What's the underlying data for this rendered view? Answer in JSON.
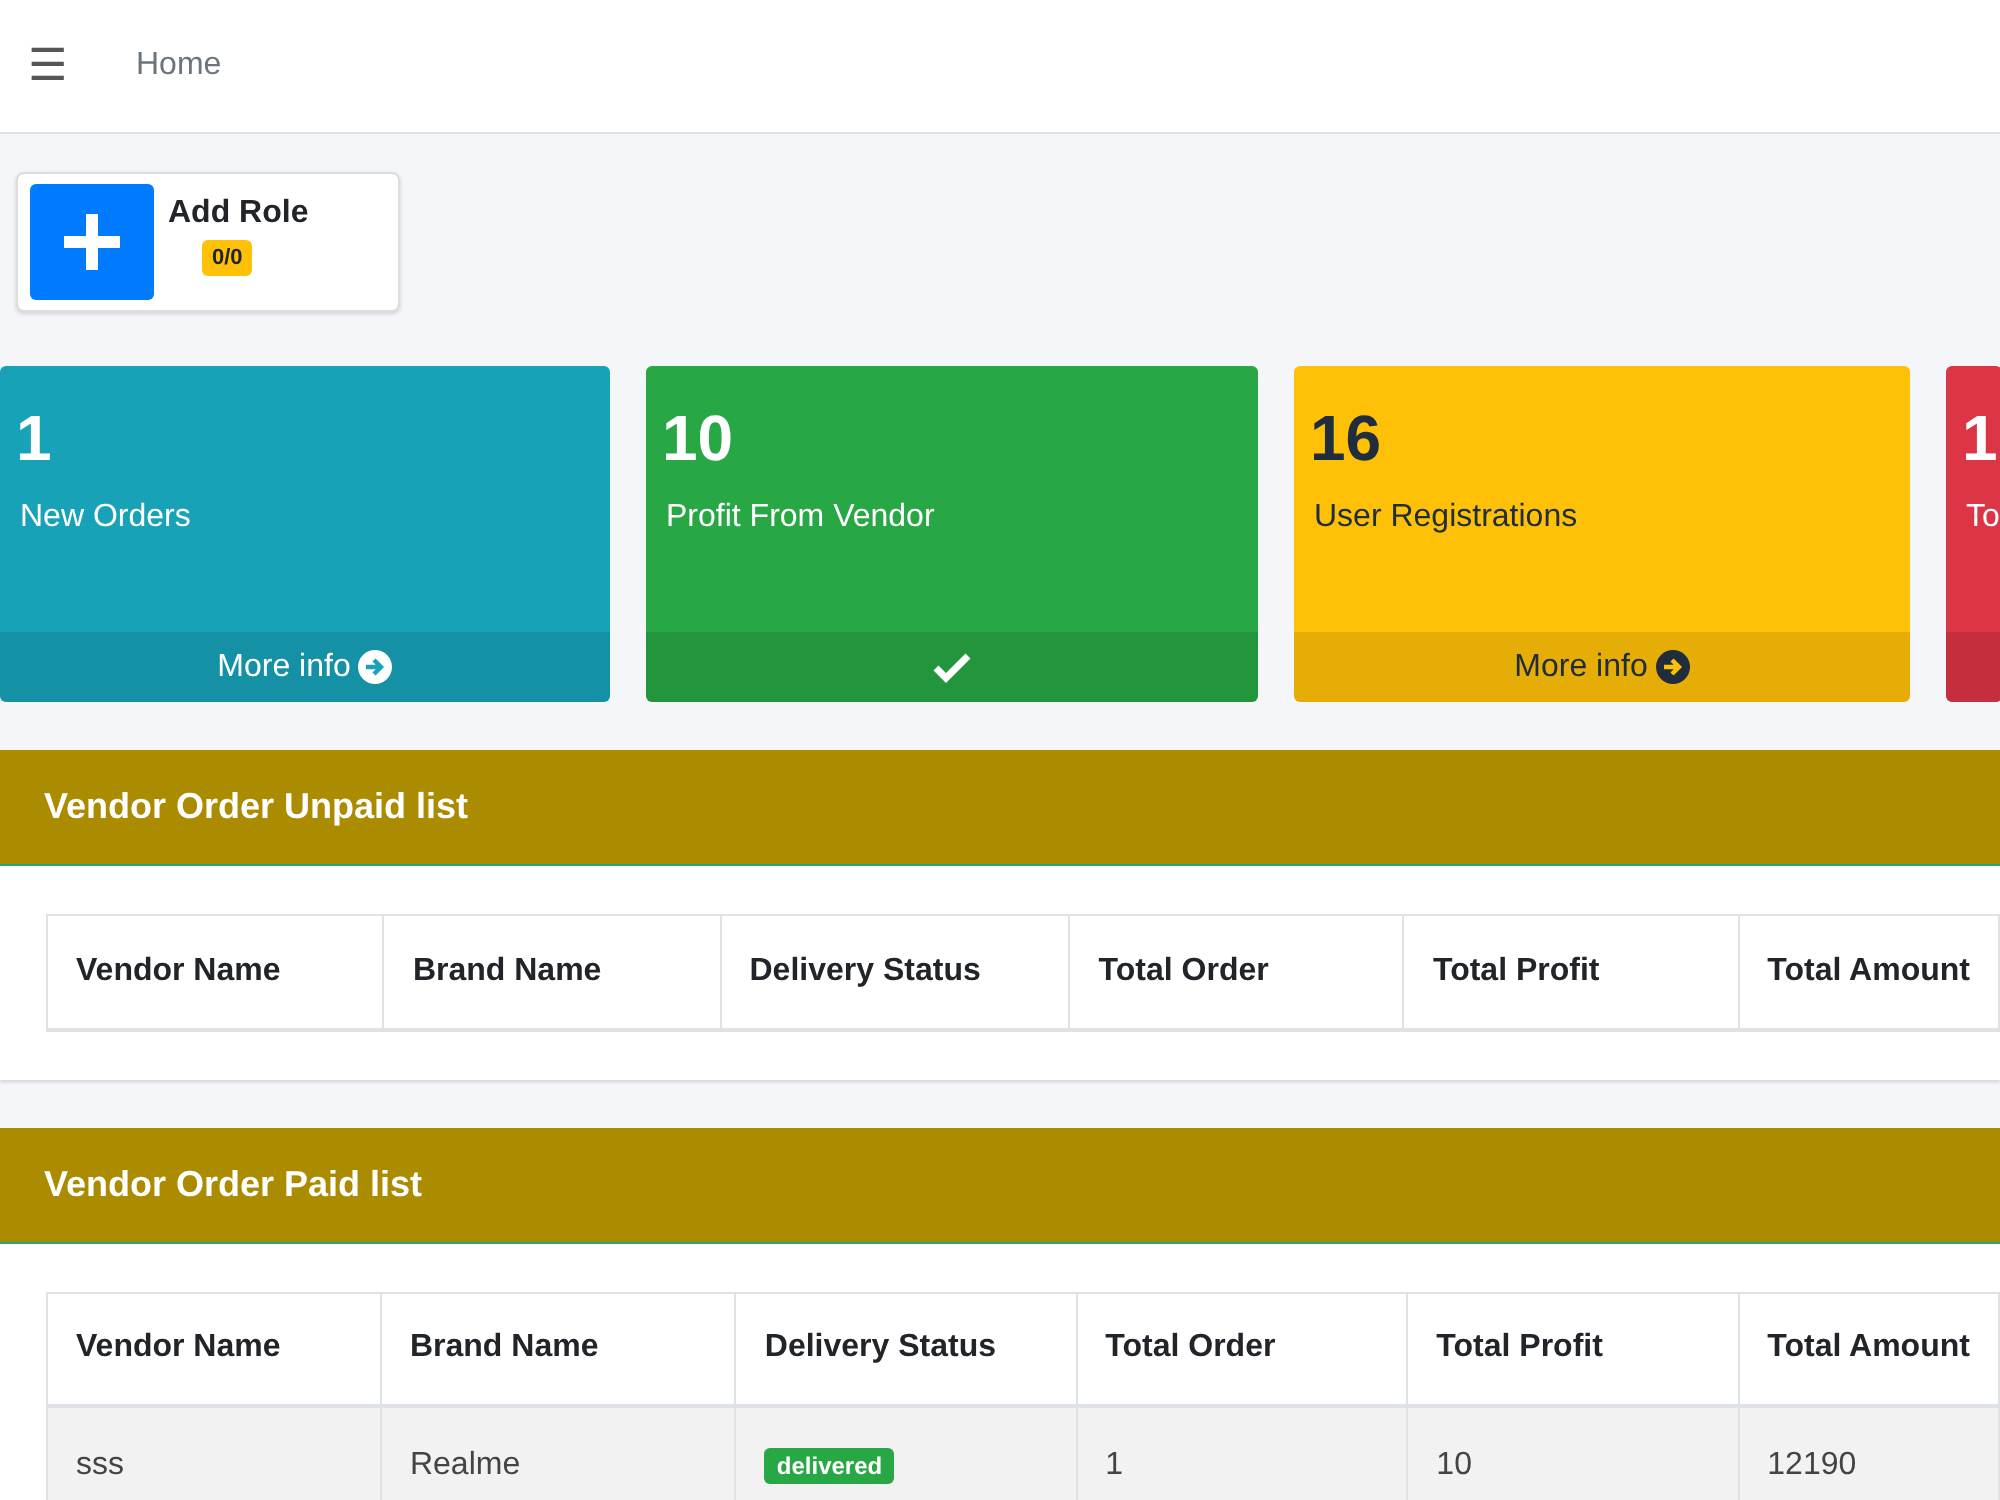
{
  "header": {
    "menu_icon": "☰",
    "breadcrumb": "Home"
  },
  "add_role": {
    "label": "Add Role",
    "badge": "0/0"
  },
  "stat_cards": [
    {
      "value": "1",
      "label": "New Orders",
      "kind": "link",
      "footer": "More info",
      "color": "#17a2b8"
    },
    {
      "value": "10",
      "label": "Profit From Vendor",
      "kind": "check",
      "color": "#28a745"
    },
    {
      "value": "16",
      "label": "User Registrations",
      "kind": "link",
      "footer": "More info",
      "color": "#ffc107"
    },
    {
      "value": "1",
      "label": "To",
      "kind": "plain",
      "color": "#dc3545"
    }
  ],
  "unpaid": {
    "title": "Vendor Order Unpaid list",
    "columns": [
      "Vendor Name",
      "Brand Name",
      "Delivery Status",
      "Total Order",
      "Total Profit",
      "Total Amount"
    ]
  },
  "paid": {
    "title": "Vendor Order Paid list",
    "columns": [
      "Vendor Name",
      "Brand Name",
      "Delivery Status",
      "Total Order",
      "Total Profit",
      "Total Amount"
    ],
    "rows": [
      {
        "vendor": "sss",
        "brand": "Realme",
        "status": "delivered",
        "total_order": "1",
        "total_profit": "10",
        "total_amount": "12190"
      }
    ]
  }
}
